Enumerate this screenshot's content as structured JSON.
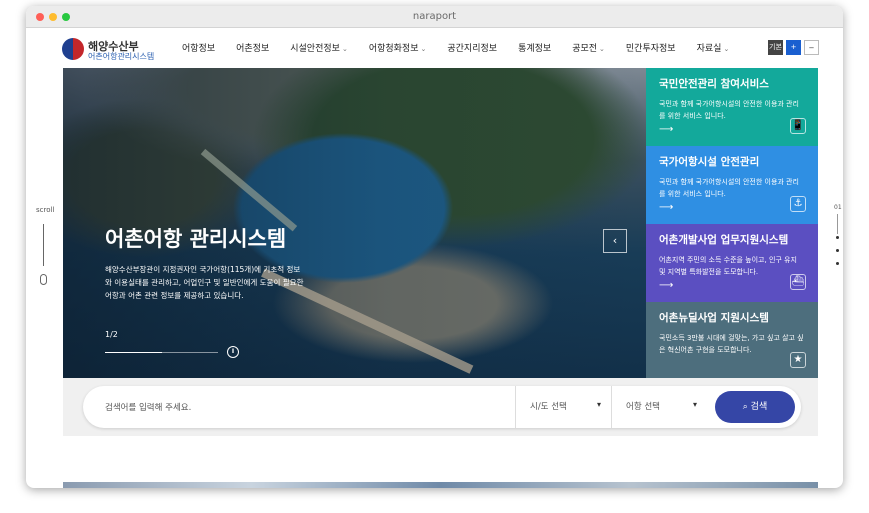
{
  "window": {
    "title": "naraport"
  },
  "logo": {
    "ministry": "해양수산부",
    "system": "어촌어항관리시스템"
  },
  "nav": {
    "items": [
      "어항정보",
      "어촌정보",
      "시설안전정보",
      "어항청화정보",
      "공간지리정보",
      "통계정보",
      "공모전",
      "민간투자정보",
      "자료실"
    ]
  },
  "header_buttons": {
    "basic": "기본",
    "plus": "+",
    "minus": "−"
  },
  "hero": {
    "title": "어촌어항 관리시스템",
    "desc": "해양수산부장관이 지정권자인 국가어항(115개)에 기초적 정보와 이용실태를 관리하고, 어업인구 및 일반인에게 도움이 필요한 어항과 어촌 관련 정보를 제공하고 있습니다.",
    "pager": "1/2",
    "progress": 0.5,
    "pause": "Ⅱ",
    "next": "‹"
  },
  "services": [
    {
      "title": "국민안전관리 참여서비스",
      "desc": "국민과 함께 국가어항시설의 안전한 이용과 관리를 위한 서비스 입니다.",
      "arrow": "⟶",
      "icon": "📱",
      "icon_name": "mobile-icon",
      "color": "#13a99b"
    },
    {
      "title": "국가어항시설 안전관리",
      "desc": "국민과 함께 국가어항시설의 안전한 이용과 관리를 위한 서비스 입니다.",
      "arrow": "⟶",
      "icon": "⚓",
      "icon_name": "lighthouse-icon",
      "color": "#2f8fe3"
    },
    {
      "title": "어촌개발사업 업무지원시스템",
      "desc": "어촌지역 주민의 소득 수준을 높이고, 인구 유지 및 지역별 특화발전을 도모합니다.",
      "arrow": "⟶",
      "icon": "⛴",
      "icon_name": "ship-icon",
      "color": "#5b4fc1"
    },
    {
      "title": "어촌뉴딜사업 지원시스템",
      "desc": "국민소득 3만불 시대에 걸맞는, 가고 싶고 살고 싶은 혁신어촌 구현을 도모합니다.",
      "arrow": "⟶",
      "icon": "★",
      "icon_name": "star-icon",
      "color": "#4d6e7d"
    }
  ],
  "search": {
    "placeholder": "검색어를 입력해 주세요.",
    "region": "시/도 선택",
    "port": "어항 선택",
    "button": "검색",
    "caret": "▾",
    "search_icon": "⌕"
  },
  "side": {
    "scroll": "scroll",
    "page_num": "01"
  }
}
